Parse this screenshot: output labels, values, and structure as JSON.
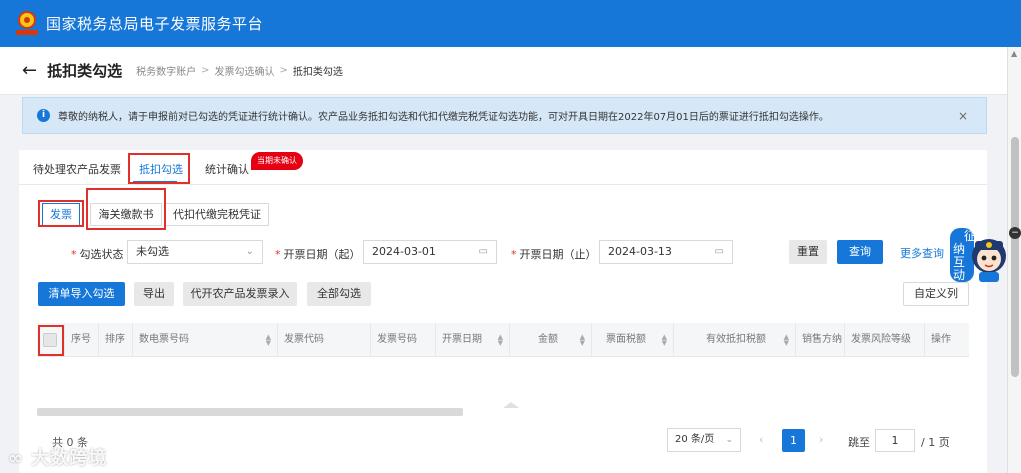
{
  "app": {
    "title": "国家税务总局电子发票服务平台"
  },
  "header": {
    "back_icon": "arrow-left-icon",
    "page_title": "抵扣类勾选",
    "breadcrumb": [
      "税务数字账户",
      "发票勾选确认",
      "抵扣类勾选"
    ],
    "separator": ">"
  },
  "notice": {
    "text": "尊敬的纳税人，请于申报前对已勾选的凭证进行统计确认。农产品业务抵扣勾选和代扣代缴完税凭证勾选功能，可对开具日期在2022年07月01日后的票证进行抵扣勾选操作。",
    "icon": "info-icon",
    "close": "×"
  },
  "tabs": [
    {
      "label": "待处理农产品发票"
    },
    {
      "label": "抵扣勾选",
      "active": true
    },
    {
      "label": "统计确认"
    }
  ],
  "tab_badge": "当期未确认",
  "subtabs": [
    {
      "label": "发票",
      "active": true
    },
    {
      "label": "海关缴款书"
    },
    {
      "label": "代扣代缴完税凭证"
    }
  ],
  "filters": {
    "status": {
      "label": "勾选状态",
      "value": "未勾选"
    },
    "start": {
      "label": "开票日期（起）",
      "value": "2024-03-01"
    },
    "end": {
      "label": "开票日期（止）",
      "value": "2024-03-13"
    }
  },
  "buttons": {
    "reset": "重置",
    "query": "查询",
    "more": "更多查询",
    "import": "清单导入勾选",
    "export": "导出",
    "agri": "代开农产品发票录入",
    "select_all": "全部勾选",
    "custom_cols": "自定义列"
  },
  "table": {
    "columns": [
      "序号",
      "排序",
      "数电票号码",
      "发票代码",
      "发票号码",
      "开票日期",
      "金额",
      "票面税额",
      "有效抵扣税额",
      "销售方纳",
      "发票风险等级",
      "操作"
    ]
  },
  "pagination": {
    "total": "共 0 条",
    "page_size": "20 条/页",
    "current_page": "1",
    "jump_label": "跳至",
    "jump_value": "1",
    "total_pages": "/ 1 页"
  },
  "mascot": {
    "text": [
      "征",
      "纳",
      "互",
      "动"
    ]
  },
  "watermark": "大数跨境",
  "colors": {
    "primary": "#1677d9",
    "highlight": "#e0302a",
    "badge": "#e60012",
    "notice_bg": "#d6e8f8"
  }
}
